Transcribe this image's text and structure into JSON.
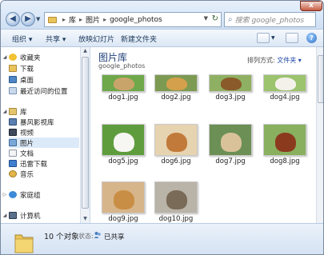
{
  "address": {
    "crumbs": [
      "库",
      "图片",
      "google_photos"
    ],
    "search_placeholder": "搜索 google_photos"
  },
  "toolbar": {
    "organize": "组织 ▾",
    "share": "共享 ▾",
    "slideshow": "放映幻灯片",
    "new_folder": "新建文件夹"
  },
  "sidebar": {
    "items": [
      {
        "label": "收藏夹",
        "icon": "star-icon",
        "kind": "header"
      },
      {
        "label": "下载",
        "icon": "download-folder-icon",
        "kind": "item"
      },
      {
        "label": "桌面",
        "icon": "desktop-icon",
        "kind": "item"
      },
      {
        "label": "最近访问的位置",
        "icon": "recent-places-icon",
        "kind": "item"
      },
      {
        "label": "库",
        "icon": "library-icon",
        "kind": "header"
      },
      {
        "label": "暴风影视库",
        "icon": "video-library-icon",
        "kind": "item"
      },
      {
        "label": "视频",
        "icon": "video-icon",
        "kind": "item"
      },
      {
        "label": "图片",
        "icon": "pictures-icon",
        "kind": "item",
        "selected": true
      },
      {
        "label": "文档",
        "icon": "documents-icon",
        "kind": "item"
      },
      {
        "label": "迅雷下载",
        "icon": "thunder-download-icon",
        "kind": "item"
      },
      {
        "label": "音乐",
        "icon": "music-icon",
        "kind": "item"
      },
      {
        "label": "家庭组",
        "icon": "homegroup-icon",
        "kind": "header"
      },
      {
        "label": "计算机",
        "icon": "computer-icon",
        "kind": "header"
      }
    ]
  },
  "main": {
    "title": "图片库",
    "subtitle": "google_photos",
    "arrange_label": "排列方式:",
    "arrange_value": "文件夹 ▾"
  },
  "files": [
    {
      "name": "dog1.jpg",
      "bg": "#6ea84a",
      "dog": "#c9a46a"
    },
    {
      "name": "dog2.jpg",
      "bg": "#7c9a52",
      "dog": "#d4a04c"
    },
    {
      "name": "dog3.jpg",
      "bg": "#8fb062",
      "dog": "#8a5a2a"
    },
    {
      "name": "dog4.jpg",
      "bg": "#9cc36e",
      "dog": "#f4f1ea"
    },
    {
      "name": "dog5.jpg",
      "bg": "#5f9c3e",
      "dog": "#f6f6f2"
    },
    {
      "name": "dog6.jpg",
      "bg": "#e6d3b0",
      "dog": "#c27a3a"
    },
    {
      "name": "dog7.jpg",
      "bg": "#6c8f55",
      "dog": "#d9c29a"
    },
    {
      "name": "dog8.jpg",
      "bg": "#88b05e",
      "dog": "#8c3a1e"
    },
    {
      "name": "dog9.jpg",
      "bg": "#d7b58a",
      "dog": "#c98e45"
    },
    {
      "name": "dog10.jpg",
      "bg": "#b9b3a8",
      "dog": "#7a6a58"
    }
  ],
  "status": {
    "count": "10 个对象",
    "share_label": "状态:",
    "share_value": "已共享"
  }
}
